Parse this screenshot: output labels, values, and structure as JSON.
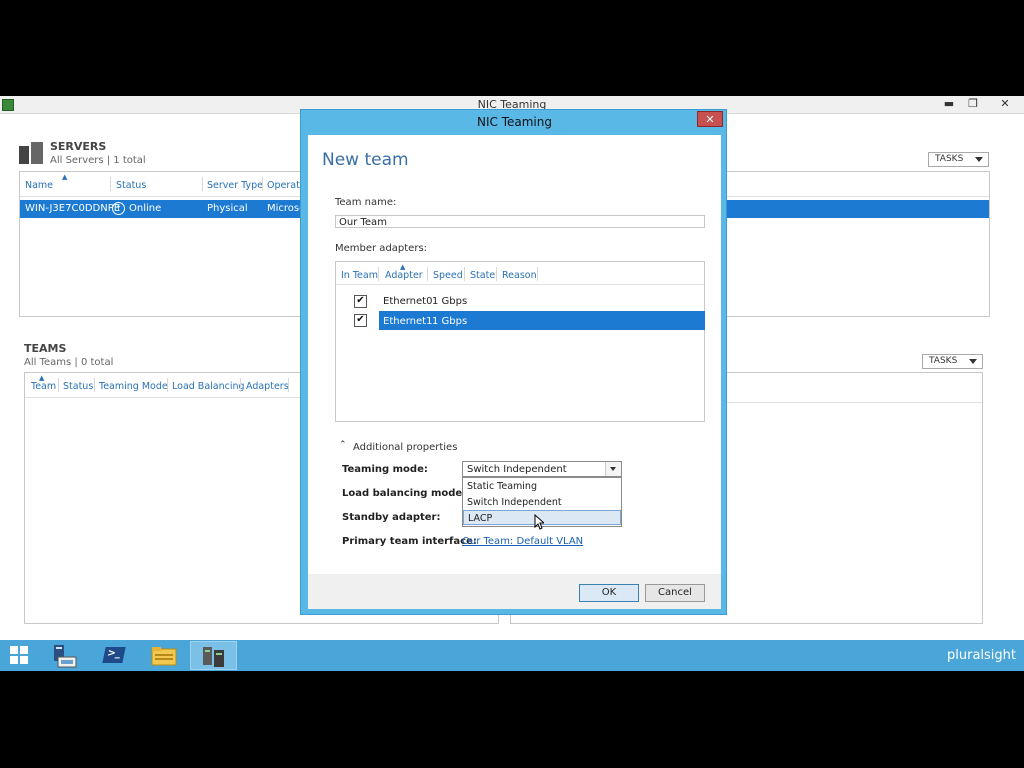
{
  "main_window": {
    "title": "NIC Teaming",
    "controls": {
      "minimize": "▬",
      "maximize": "❐",
      "close": "✕"
    }
  },
  "servers": {
    "title": "SERVERS",
    "subtitle": "All Servers | 1 total",
    "tasks_label": "TASKS",
    "columns": [
      "Name",
      "Status",
      "Server Type",
      "Operati"
    ],
    "rows": [
      {
        "name": "WIN-J3E7C0DDNPE",
        "status": "Online",
        "type": "Physical",
        "os": "Microso"
      }
    ]
  },
  "teams": {
    "title": "TEAMS",
    "subtitle": "All Teams | 0 total",
    "tasks_label": "TASKS",
    "columns": [
      "Team",
      "Status",
      "Teaming Mode",
      "Load Balancing",
      "Adapters"
    ]
  },
  "dialog": {
    "title": "NIC Teaming",
    "close": "✕",
    "heading": "New team",
    "team_name_label": "Team name:",
    "team_name_value": "Our Team",
    "member_adapters_label": "Member adapters:",
    "adapter_columns": [
      "In Team",
      "Adapter",
      "Speed",
      "State",
      "Reason"
    ],
    "adapters": [
      {
        "checked": "✔",
        "name": "Ethernet0",
        "speed": "1 Gbps"
      },
      {
        "checked": "✔",
        "name": "Ethernet1",
        "speed": "1 Gbps"
      }
    ],
    "additional_properties": "Additional properties",
    "teaming_mode_label": "Teaming mode:",
    "teaming_mode_value": "Switch Independent",
    "teaming_mode_options": [
      "Static Teaming",
      "Switch Independent",
      "LACP"
    ],
    "load_balancing_label": "Load balancing mode:",
    "standby_label": "Standby adapter:",
    "primary_label": "Primary team interface:",
    "primary_link": "Our Team: Default VLAN",
    "ok": "OK",
    "cancel": "Cancel"
  },
  "taskbar": {
    "items": [
      "start",
      "server-manager",
      "powershell",
      "file-explorer",
      "nic-teaming"
    ],
    "ps_glyph": ">_",
    "watermark": "pluralsight"
  },
  "colors": {
    "accent": "#1c7ad3",
    "dialog_frame": "#59b8e6",
    "taskbar": "#4aa6d9",
    "link": "#1a63b0"
  }
}
